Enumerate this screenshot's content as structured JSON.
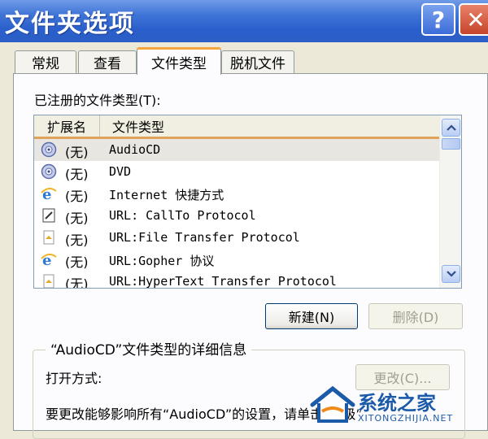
{
  "window": {
    "title": "文件夹选项",
    "help_label": "?",
    "close_label": "✕"
  },
  "tabs": [
    {
      "label": "常规",
      "active": false
    },
    {
      "label": "查看",
      "active": false
    },
    {
      "label": "文件类型",
      "active": true
    },
    {
      "label": "脱机文件",
      "active": false
    }
  ],
  "list_label": "已注册的文件类型(T):",
  "columns": {
    "ext": "扩展名",
    "type": "文件类型"
  },
  "rows": [
    {
      "ext": "(无)",
      "type": "AudioCD",
      "icon": "cd-icon",
      "selected": true
    },
    {
      "ext": "(无)",
      "type": "DVD",
      "icon": "cd-icon",
      "selected": false
    },
    {
      "ext": "(无)",
      "type": "Internet 快捷方式",
      "icon": "ie-icon",
      "selected": false
    },
    {
      "ext": "(无)",
      "type": "URL: CallTo Protocol",
      "icon": "callto-icon",
      "selected": false
    },
    {
      "ext": "(无)",
      "type": "URL:File Transfer Protocol",
      "icon": "folder-url-icon",
      "selected": false
    },
    {
      "ext": "(无)",
      "type": "URL:Gopher 协议",
      "icon": "ie-icon",
      "selected": false
    },
    {
      "ext": "(无)",
      "type": "URL:HyperText Transfer Protocol",
      "icon": "folder-url-icon",
      "selected": false
    }
  ],
  "buttons": {
    "new_label": "新建(N)",
    "delete_label": "删除(D)",
    "change_label": "更改(C)..."
  },
  "details": {
    "title": "“AudioCD”文件类型的详细信息",
    "open_with_label": "打开方式:",
    "info_text": "要更改能够影响所有“AudioCD”的设置，请单击“高级”"
  },
  "watermark": {
    "text": "系统之家",
    "sub": "XITONGZHIJIA.NET"
  },
  "colors": {
    "titlebar": "#2a5fcc",
    "active_tab_accent": "#f5a53d",
    "window_bg": "#ece9d8"
  }
}
